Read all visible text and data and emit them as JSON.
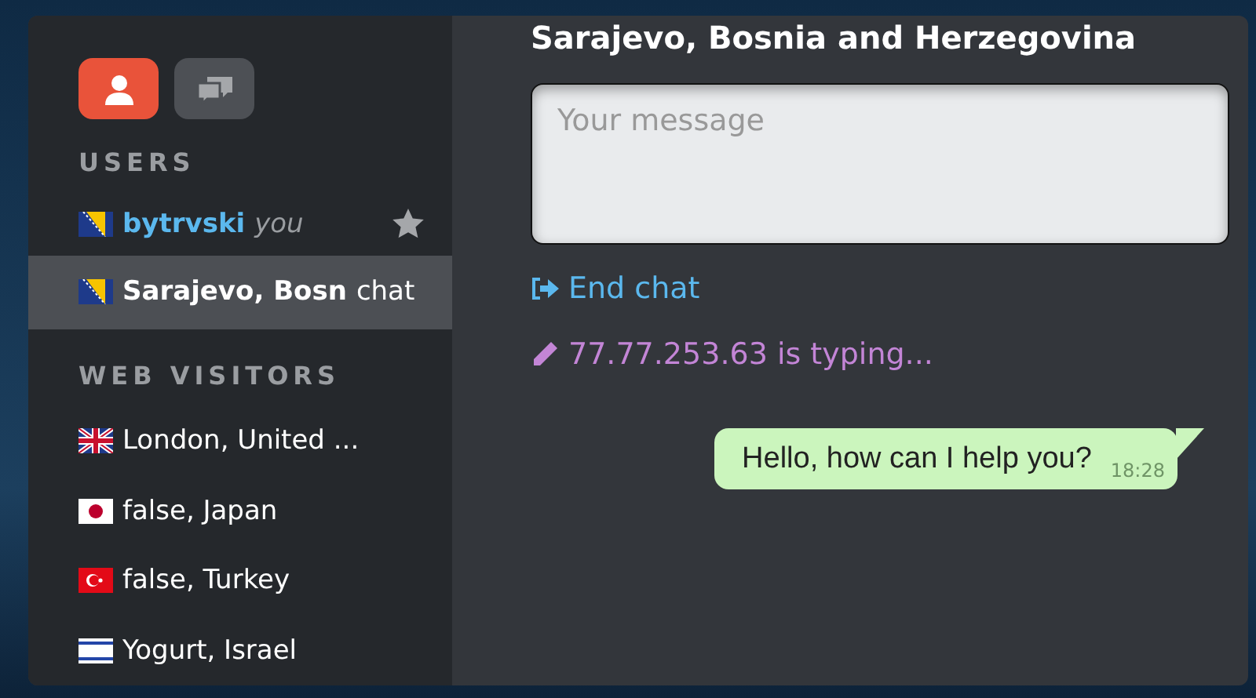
{
  "sidebar": {
    "tabs": [
      {
        "selected": true
      },
      {
        "selected": false
      }
    ],
    "users_heading": "USERS",
    "users": [
      {
        "kind": "bosnia",
        "name": "bytrvski",
        "note": "you",
        "starred": true
      }
    ],
    "chats": [
      {
        "kind": "bosnia",
        "name": "Sarajevo, Bosn",
        "badge": "chat",
        "selected": true
      }
    ],
    "visitors_heading": "WEB VISITORS",
    "visitors": [
      {
        "kind": "uk",
        "name": "London, United ...",
        "selected": false
      },
      {
        "kind": "japan",
        "name": "false, Japan",
        "selected": false
      },
      {
        "kind": "turkey",
        "name": "false, Turkey",
        "selected": false
      },
      {
        "kind": "israel",
        "name": "Yogurt, Israel",
        "selected": false
      }
    ]
  },
  "chat": {
    "title": "Sarajevo, Bosnia and Herzegovina",
    "message_placeholder": "Your message",
    "end_chat": "End chat",
    "typing": "77.77.253.63 is typing...",
    "messages": [
      {
        "text": "Hello, how can I help you?",
        "time": "18:28"
      }
    ]
  }
}
